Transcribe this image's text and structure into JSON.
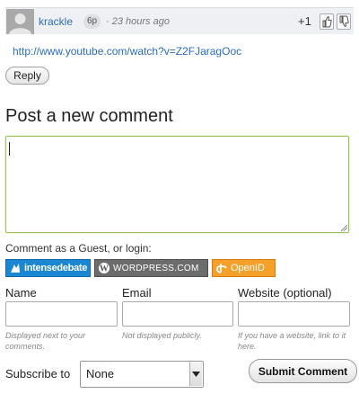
{
  "comment": {
    "author": "krackle",
    "reputation": "6p",
    "timestamp": "· 23 hours ago",
    "score": "+1",
    "body_link": "http://www.youtube.com/watch?v=Z2FJaragOoc",
    "reply_label": "Reply",
    "avatar_icon": "default-avatar-icon",
    "vote_up_icon": "thumbs-up-icon",
    "vote_down_icon": "thumbs-down-icon"
  },
  "form": {
    "title": "Post a new comment",
    "comment_value": "",
    "login_label": "Comment as a Guest, or login:",
    "login_buttons": [
      {
        "label": "intensedebate",
        "icon": "intensedebate-icon",
        "color": "#1b86d1"
      },
      {
        "label": "WordPress.com",
        "icon": "wordpress-icon",
        "color": "#6c6c6c"
      },
      {
        "label": "OpenID",
        "icon": "openid-icon",
        "color": "#f4a02a"
      }
    ],
    "fields": [
      {
        "label": "Name",
        "value": "",
        "help": "Displayed next to your comments."
      },
      {
        "label": "Email",
        "value": "",
        "help": "Not displayed publicly."
      },
      {
        "label": "Website (optional)",
        "value": "",
        "help": "If you have a website, link to it here."
      }
    ],
    "subscribe_label": "Subscribe to",
    "subscribe_value": "None",
    "submit_label": "Submit Comment"
  },
  "colors": {
    "link": "#2a6ebb",
    "focus_border": "#9fc35a",
    "header_bg": "#eef0f3"
  }
}
